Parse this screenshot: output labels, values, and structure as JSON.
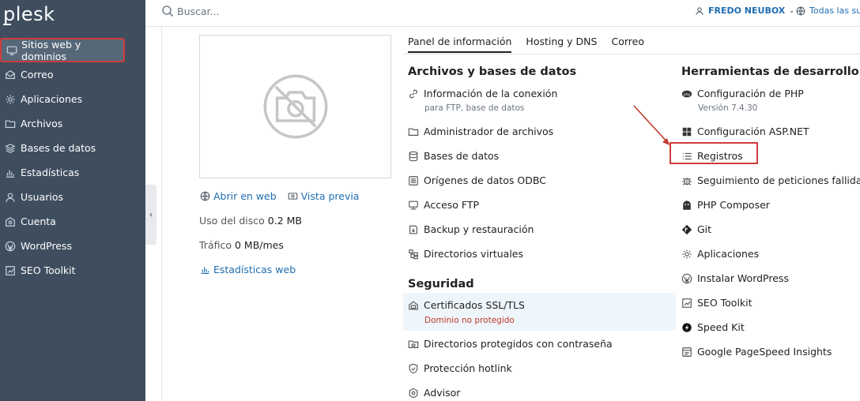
{
  "brand": {
    "logo": "plesk"
  },
  "sidebar": {
    "items": [
      {
        "label": "Sitios web y dominios",
        "icon": "monitor-icon"
      },
      {
        "label": "Correo",
        "icon": "mail-icon"
      },
      {
        "label": "Aplicaciones",
        "icon": "gear-icon"
      },
      {
        "label": "Archivos",
        "icon": "folder-icon"
      },
      {
        "label": "Bases de datos",
        "icon": "database-icon"
      },
      {
        "label": "Estadísticas",
        "icon": "bar-chart-icon"
      },
      {
        "label": "Usuarios",
        "icon": "user-icon"
      },
      {
        "label": "Cuenta",
        "icon": "account-icon"
      },
      {
        "label": "WordPress",
        "icon": "wordpress-icon"
      },
      {
        "label": "SEO Toolkit",
        "icon": "seo-icon"
      }
    ]
  },
  "topbar": {
    "search_placeholder": "Buscar...",
    "user": "FREDO NEUBOX",
    "subscriptions": "Todas las sus"
  },
  "preview": {
    "open_web": "Abrir en web",
    "preview_link": "Vista previa",
    "disk_label": "Uso del disco",
    "disk_value": "0.2 MB",
    "traffic_label": "Tráfico",
    "traffic_value": "0 MB/mes",
    "web_stats": "Estadísticas web"
  },
  "tabs": [
    {
      "label": "Panel de información",
      "active": true
    },
    {
      "label": "Hosting y DNS",
      "active": false
    },
    {
      "label": "Correo",
      "active": false
    }
  ],
  "files_db": {
    "title": "Archivos y bases de datos",
    "connection_info": "Información de la conexión",
    "connection_sub": "para FTP, base de datos",
    "file_manager": "Administrador de archivos",
    "databases": "Bases de datos",
    "odbc": "Orígenes de datos ODBC",
    "ftp": "Acceso FTP",
    "backup": "Backup y restauración",
    "virtual_dirs": "Directorios virtuales"
  },
  "security": {
    "title": "Seguridad",
    "ssl": "Certificados SSL/TLS",
    "ssl_sub": "Dominio no protegido",
    "protected_dirs": "Directorios protegidos con contraseña",
    "hotlink": "Protección hotlink",
    "advisor": "Advisor"
  },
  "dev_tools": {
    "title": "Herramientas de desarrollo",
    "php": "Configuración de PHP",
    "php_version": "Versión 7.4.30",
    "aspnet": "Configuración ASP.NET",
    "logs": "Registros",
    "failed_requests": "Seguimiento de peticiones fallidas",
    "composer": "PHP Composer",
    "git": "Git",
    "apps": "Aplicaciones",
    "install_wp": "Instalar WordPress",
    "seo_toolkit": "SEO Toolkit",
    "speed_kit": "Speed Kit",
    "pagespeed": "Google PageSpeed Insights"
  },
  "colors": {
    "sidebar": "#3e4e5f",
    "link": "#1f6db0",
    "highlight": "#d23b3b"
  }
}
